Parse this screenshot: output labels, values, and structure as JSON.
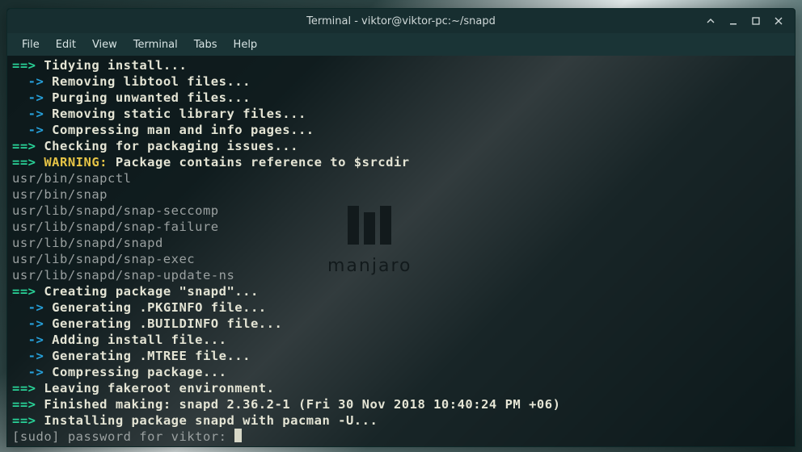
{
  "titlebar": {
    "title": "Terminal - viktor@viktor-pc:~/snapd"
  },
  "menubar": {
    "items": [
      "File",
      "Edit",
      "View",
      "Terminal",
      "Tabs",
      "Help"
    ]
  },
  "wallpaper": {
    "brand": "manjaro"
  },
  "terminal": {
    "lines": [
      {
        "type": "step",
        "text": "Tidying install..."
      },
      {
        "type": "sub",
        "text": "Removing libtool files..."
      },
      {
        "type": "sub",
        "text": "Purging unwanted files..."
      },
      {
        "type": "sub",
        "text": "Removing static library files..."
      },
      {
        "type": "sub",
        "text": "Compressing man and info pages..."
      },
      {
        "type": "step",
        "text": "Checking for packaging issues..."
      },
      {
        "type": "warn",
        "text": "Package contains reference to $srcdir"
      },
      {
        "type": "plain",
        "text": "usr/bin/snapctl"
      },
      {
        "type": "plain",
        "text": "usr/bin/snap"
      },
      {
        "type": "plain",
        "text": "usr/lib/snapd/snap-seccomp"
      },
      {
        "type": "plain",
        "text": "usr/lib/snapd/snap-failure"
      },
      {
        "type": "plain",
        "text": "usr/lib/snapd/snapd"
      },
      {
        "type": "plain",
        "text": "usr/lib/snapd/snap-exec"
      },
      {
        "type": "plain",
        "text": "usr/lib/snapd/snap-update-ns"
      },
      {
        "type": "step",
        "text": "Creating package \"snapd\"..."
      },
      {
        "type": "sub",
        "text": "Generating .PKGINFO file..."
      },
      {
        "type": "sub",
        "text": "Generating .BUILDINFO file..."
      },
      {
        "type": "sub",
        "text": "Adding install file..."
      },
      {
        "type": "sub",
        "text": "Generating .MTREE file..."
      },
      {
        "type": "sub",
        "text": "Compressing package..."
      },
      {
        "type": "step",
        "text": "Leaving fakeroot environment."
      },
      {
        "type": "step",
        "text": "Finished making: snapd 2.36.2-1 (Fri 30 Nov 2018 10:40:24 PM +06)"
      },
      {
        "type": "step",
        "text": "Installing package snapd with pacman -U..."
      },
      {
        "type": "prompt",
        "text": "[sudo] password for viktor: "
      }
    ],
    "markers": {
      "step": "==>",
      "sub": "  ->",
      "warn_prefix": "==>",
      "warn_label": "WARNING:"
    }
  },
  "colors": {
    "titlebar_bg": "#172e30",
    "menubar_bg": "#1a3436",
    "term_bg": "rgba(10,20,22,0.82)",
    "green": "#29d398",
    "blue": "#26a0da",
    "yellow": "#e6c446",
    "grey": "#9aa0a0",
    "white": "#e4e4d4"
  }
}
